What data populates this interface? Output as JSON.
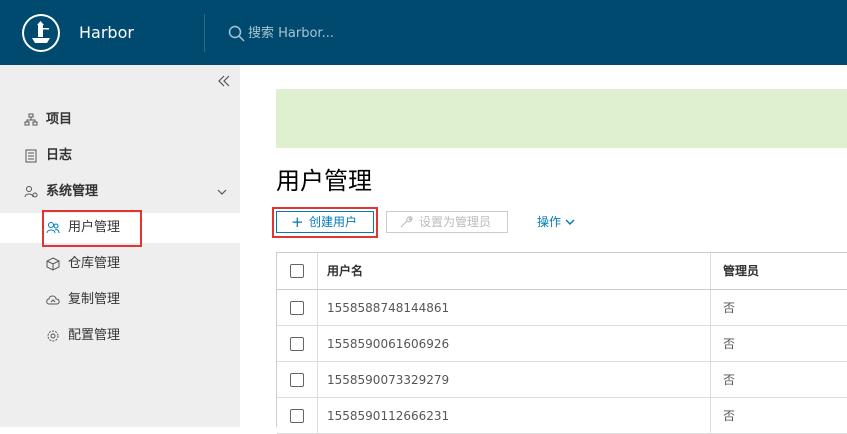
{
  "header": {
    "brand": "Harbor",
    "search_placeholder": "搜索 Harbor..."
  },
  "sidebar": {
    "items": [
      {
        "label": "项目",
        "icon": "project-icon"
      },
      {
        "label": "日志",
        "icon": "log-icon"
      },
      {
        "label": "系统管理",
        "icon": "system-admin-icon"
      }
    ],
    "subitems": [
      {
        "label": "用户管理",
        "icon": "users-icon",
        "active": true
      },
      {
        "label": "仓库管理",
        "icon": "registry-icon"
      },
      {
        "label": "复制管理",
        "icon": "replication-icon"
      },
      {
        "label": "配置管理",
        "icon": "config-icon"
      }
    ]
  },
  "main": {
    "title": "用户管理",
    "create_button": "创建用户",
    "set_admin_button": "设置为管理员",
    "actions_label": "操作"
  },
  "table": {
    "columns": [
      "用户名",
      "管理员"
    ],
    "rows": [
      {
        "username": "1558588748144861",
        "admin": "否"
      },
      {
        "username": "1558590061606926",
        "admin": "否"
      },
      {
        "username": "1558590073329279",
        "admin": "否"
      },
      {
        "username": "1558590112666231",
        "admin": "否"
      }
    ]
  },
  "colors": {
    "header_bg": "#004a70",
    "accent": "#0079b8",
    "banner_bg": "#dff0d0",
    "highlight": "#e03530"
  }
}
